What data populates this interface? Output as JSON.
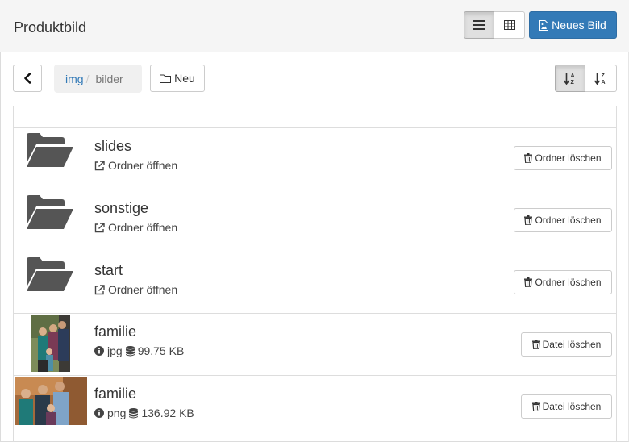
{
  "header": {
    "title": "Produktbild",
    "new_image_label": "Neues Bild",
    "view_modes": [
      "list",
      "grid"
    ],
    "active_view": "list"
  },
  "toolbar": {
    "breadcrumb": [
      {
        "label": "img",
        "separator": "/"
      },
      {
        "label": "bilder"
      }
    ],
    "new_folder_label": "Neu",
    "sort_modes": [
      "a-z",
      "z-a"
    ],
    "active_sort": "a-z"
  },
  "folders": [
    {
      "name": "slides",
      "open_label": "Ordner öffnen",
      "delete_label": "Ordner löschen"
    },
    {
      "name": "sonstige",
      "open_label": "Ordner öffnen",
      "delete_label": "Ordner löschen"
    },
    {
      "name": "start",
      "open_label": "Ordner öffnen",
      "delete_label": "Ordner löschen"
    }
  ],
  "files": [
    {
      "name": "familie",
      "type": "jpg",
      "size": "99.75 KB",
      "delete_label": "Datei löschen"
    },
    {
      "name": "familie",
      "type": "png",
      "size": "136.92 KB",
      "delete_label": "Datei löschen"
    }
  ],
  "colors": {
    "primary": "#337ab7",
    "header_bg": "#f5f5f5",
    "breadcrumb_bg": "#f0f0f0",
    "folder_icon": "#555555"
  }
}
